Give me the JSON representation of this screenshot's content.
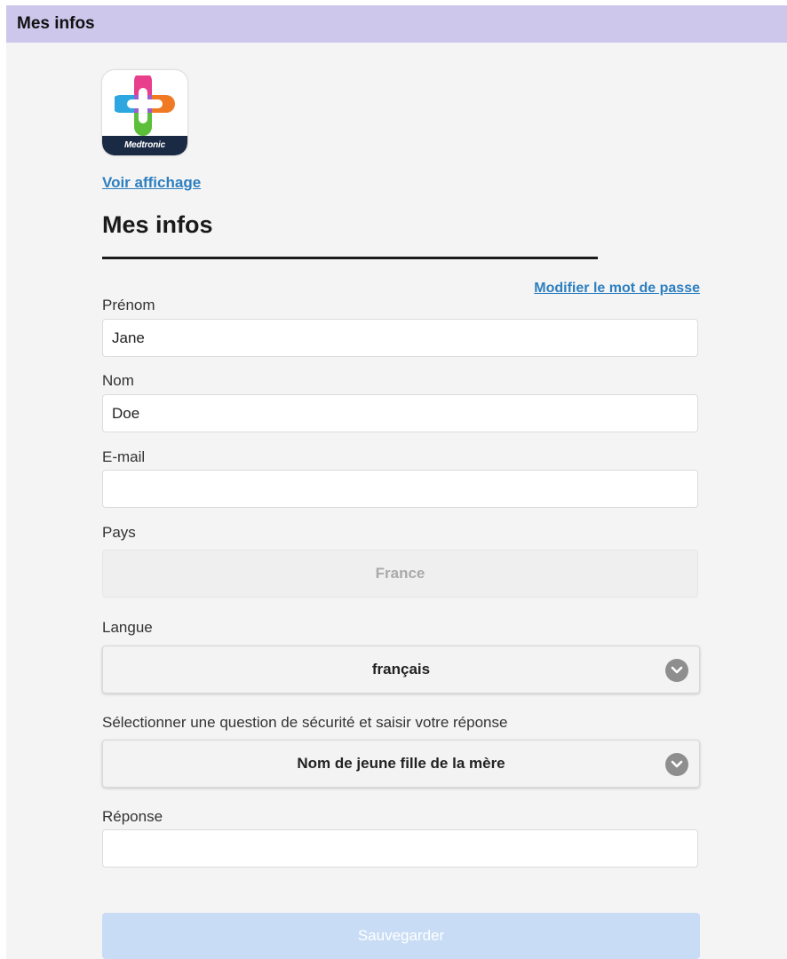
{
  "window": {
    "title": "Mes infos"
  },
  "brand": {
    "logo_text": "Medtronic"
  },
  "links": {
    "voir_affichage": "Voir affichage",
    "modifier_mot_de_passe": "Modifier le mot de passe"
  },
  "page": {
    "heading": "Mes infos"
  },
  "form": {
    "prenom": {
      "label": "Prénom",
      "value": "Jane"
    },
    "nom": {
      "label": "Nom",
      "value": "Doe"
    },
    "email": {
      "label": "E-mail",
      "value": ""
    },
    "pays": {
      "label": "Pays",
      "value": "France"
    },
    "langue": {
      "label": "Langue",
      "value": "français"
    },
    "question": {
      "label": "Sélectionner une question de sécurité et saisir votre réponse",
      "value": "Nom de jeune fille de la mère"
    },
    "reponse": {
      "label": "Réponse",
      "value": ""
    }
  },
  "actions": {
    "save_label": "Sauvegarder"
  },
  "colors": {
    "titlebar": "#cdc7ec",
    "link": "#2d7fc0",
    "save_button_disabled": "#c8dcf6",
    "logo_band": "#1b2a44"
  },
  "icons": [
    "medtronic-logo-icon",
    "chevron-down-icon"
  ]
}
